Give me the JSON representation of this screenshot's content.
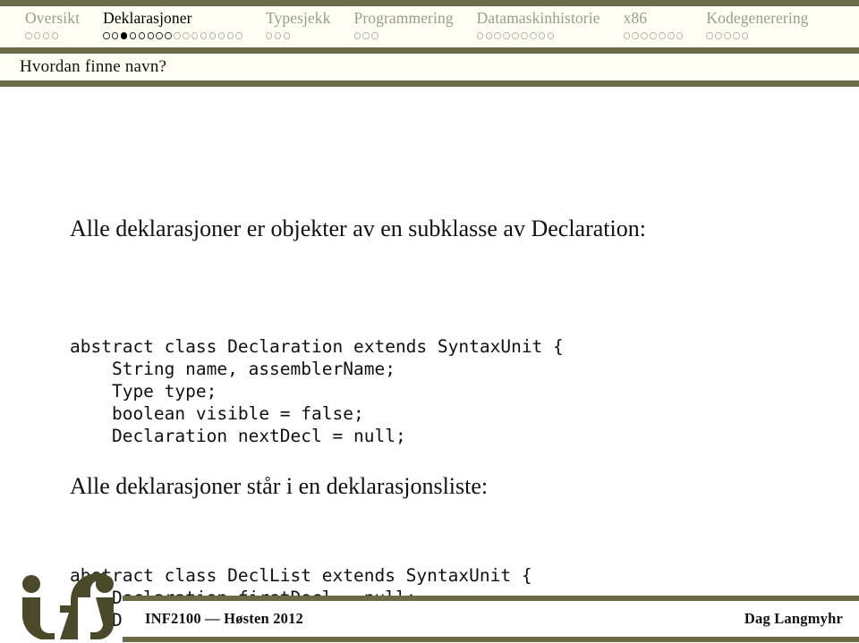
{
  "nav": {
    "sections": [
      {
        "label": "Oversikt",
        "active": false,
        "dots_total": 4,
        "dots_seen": 0,
        "current_index": -1
      },
      {
        "label": "Deklarasjoner",
        "active": true,
        "dots_total": 16,
        "dots_seen": 8,
        "current_index": 2
      },
      {
        "label": "Typesjekk",
        "active": false,
        "dots_total": 3,
        "dots_seen": 0,
        "current_index": -1
      },
      {
        "label": "Programmering",
        "active": false,
        "dots_total": 3,
        "dots_seen": 0,
        "current_index": -1
      },
      {
        "label": "Datamaskinhistorie",
        "active": false,
        "dots_total": 9,
        "dots_seen": 0,
        "current_index": -1
      },
      {
        "label": "x86",
        "active": false,
        "dots_total": 7,
        "dots_seen": 0,
        "current_index": -1
      },
      {
        "label": "Kodegenerering",
        "active": false,
        "dots_total": 5,
        "dots_seen": 0,
        "current_index": -1
      }
    ]
  },
  "slide": {
    "title": "Hvordan finne navn?",
    "paragraph_1": "Alle deklarasjoner er objekter av en subklasse av Declaration:",
    "code_1": "abstract class Declaration extends SyntaxUnit {\n    String name, assemblerName;\n    Type type;\n    boolean visible = false;\n    Declaration nextDecl = null;",
    "paragraph_2": "Alle deklarasjoner står i en deklarasjonsliste:",
    "code_2": "abstract class DeclList extends SyntaxUnit {\n    Declaration firstDecl = null;\n    DeclList outerScope;"
  },
  "footer": {
    "logo_text": "ifi",
    "course": "INF2100 — Høsten 2012",
    "author": "Dag Langmyhr"
  },
  "colors": {
    "olive": "#6b6b47",
    "nav_inactive_text": "#9b9b8c",
    "nav_active_text": "#000000",
    "band_background": "#fffff4",
    "page_background": "#ffffff",
    "body_text": "#111111"
  }
}
